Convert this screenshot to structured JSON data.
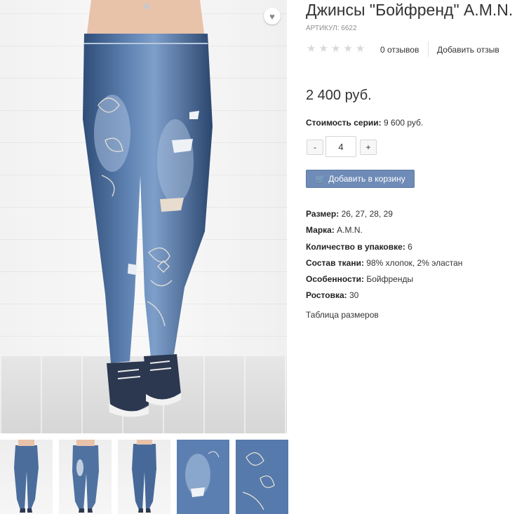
{
  "product": {
    "title": "Джинсы \"Бойфренд\" A.M.N.",
    "sku": "АРТИКУЛ: 6622",
    "rating": {
      "stars": 5,
      "filled": 0
    },
    "reviews_count": "0 отзывов",
    "add_review": "Добавить отзыв",
    "price": "2 400 руб.",
    "series_cost_label": "Стоимость серии:",
    "series_cost_value": "9 600 руб."
  },
  "quantity": {
    "minus": "-",
    "value": "4",
    "plus": "+"
  },
  "cart_button": {
    "label": "Добавить в корзину",
    "icon": "cart-icon"
  },
  "attributes": [
    {
      "label": "Размер:",
      "value": "26, 27, 28, 29"
    },
    {
      "label": "Марка:",
      "value": "A.M.N."
    },
    {
      "label": "Количество в упаковке:",
      "value": "6"
    },
    {
      "label": "Состав ткани:",
      "value": "98% хлопок, 2% эластан"
    },
    {
      "label": "Особенности:",
      "value": "Бойфренды"
    },
    {
      "label": "Ростовка:",
      "value": "30"
    }
  ],
  "size_table_link": "Таблица размеров",
  "colors": {
    "denim": "#3e5f8e",
    "button": "#6f8bb7",
    "star": "#d9d9d9"
  },
  "gallery": {
    "wishlist_icon": "heart-icon",
    "thumbnail_count": 5
  }
}
